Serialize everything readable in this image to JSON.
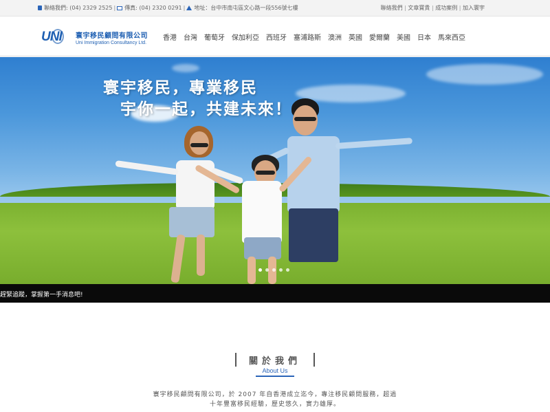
{
  "topbar": {
    "phone": "聯絡我們: (04) 2329 2525",
    "fax": "傳真: (04) 2320 0291",
    "address": "地址：台中市南屯區文心路一段556號七樓",
    "links": [
      "聯絡我們",
      "文章寶貴",
      "成功案例",
      "加入寰宇"
    ]
  },
  "logo": {
    "mark": "UNI",
    "name_cn": "寰宇移民顧問有限公司",
    "name_en": "Uni Immigration Consultancy Ltd."
  },
  "nav": [
    "香港",
    "台灣",
    "葡萄牙",
    "保加利亞",
    "西班牙",
    "塞浦路斯",
    "澳洲",
    "英國",
    "愛爾蘭",
    "美國",
    "日本",
    "馬來西亞"
  ],
  "hero": {
    "line1": "寰宇移民，專業移民",
    "line2": "宇你一起，共建未來！",
    "slide_count": 5,
    "active_slide": 0
  },
  "ticker": "趕緊追蹤，掌握第一手消息吧!",
  "about": {
    "title": "關於我們",
    "subtitle": "About Us",
    "text_line1": "寰宇移民顧問有限公司，於 2007 年自香港成立迄今，專注移民顧問服務，超過",
    "text_line2": "十年豐富移民經驗，歷史悠久，實力雄厚。"
  },
  "colors": {
    "brand_blue": "#1e5fb2",
    "ticker_bg": "#0a0a0a",
    "sky": "#4b97db",
    "grass": "#8dc03c"
  }
}
